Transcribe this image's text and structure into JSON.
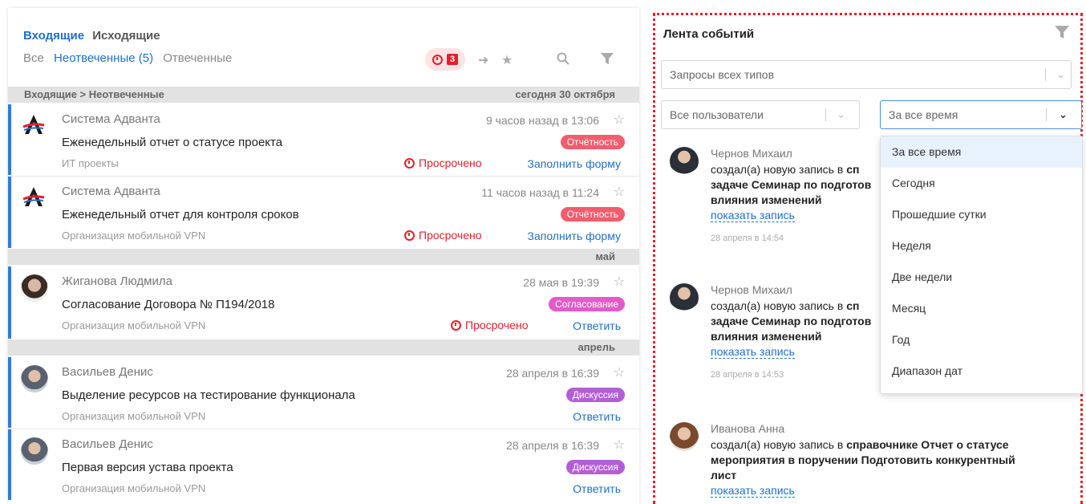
{
  "left": {
    "tabs_main": [
      "Входящие",
      "Исходящие"
    ],
    "tabs_sub": [
      "Все",
      "Неотвеченные (5)",
      "Отвеченные"
    ],
    "overdue_count": "3",
    "groups": [
      {
        "label": "Входящие  >  Неотвеченные",
        "date": "сегодня 30 октября"
      },
      {
        "label": "",
        "date": "май"
      },
      {
        "label": "",
        "date": "апрель"
      }
    ],
    "items": [
      {
        "sender": "Система Адванта",
        "time": "9 часов назад в 13:06",
        "title": "Еженедельный отчет о статусе проекта",
        "tag": "Отчётность",
        "tag_color": "#f25c6e",
        "org": "ИТ проекты",
        "overdue": "Просрочено",
        "action": "Заполнить форму"
      },
      {
        "sender": "Система Адванта",
        "time": "11 часов назад в 11:24",
        "title": "Еженедельный отчет для контроля сроков",
        "tag": "Отчётность",
        "tag_color": "#f25c6e",
        "org": "Организация мобильной VPN",
        "overdue": "Просрочено",
        "action": "Заполнить форму"
      },
      {
        "sender": "Жиганова Людмила",
        "time": "28 мая в 19:39",
        "title": "Согласование Договора № П194/2018",
        "tag": "Согласование",
        "tag_color": "#e55ac9",
        "org": "Организация мобильной VPN",
        "overdue": "Просрочено",
        "action": "Ответить"
      },
      {
        "sender": "Васильев Денис",
        "time": "28 апреля в 16:39",
        "title": "Выделение ресурсов на тестирование функционала",
        "tag": "Дискуссия",
        "tag_color": "#b35ed8",
        "org": "Организация мобильной VPN",
        "overdue": "",
        "action": "Ответить"
      },
      {
        "sender": "Васильев Денис",
        "time": "28 апреля в 16:39",
        "title": "Первая версия устава проекта",
        "tag": "Дискуссия",
        "tag_color": "#b35ed8",
        "org": "Организация мобильной VPN",
        "overdue": "",
        "action": "Ответить"
      }
    ]
  },
  "right": {
    "title": "Лента событий",
    "filter_types": "Запросы всех типов",
    "filter_users": "Все пользователи",
    "filter_period": "За все время",
    "events": [
      {
        "who": "Чернов Михаил",
        "line1_pre": "создал(а) новую запись в ",
        "line1_bold": "сп",
        "line2": "задаче Семинар по подготов",
        "line3": "влияния изменений",
        "link": "показать запись",
        "date": "28 апреля в 14:54"
      },
      {
        "who": "Чернов Михаил",
        "line1_pre": "создал(а) новую запись в ",
        "line1_bold": "сп",
        "line2": "задаче Семинар по подготов",
        "line3": "влияния изменений",
        "link": "показать запись",
        "date": "28 апреля в 14:53"
      },
      {
        "who": "Иванова Анна",
        "line1_pre": "создал(а) новую запись в ",
        "line1_bold": "справочнике Отчет о статусе",
        "line2": "мероприятия в поручении Подготовить конкурентный",
        "line3": "лист",
        "link": "показать запись",
        "date": ""
      }
    ],
    "period_options": [
      "За все время",
      "Сегодня",
      "Прошедшие сутки",
      "Неделя",
      "Две недели",
      "Месяц",
      "Год",
      "Диапазон дат"
    ]
  },
  "colors": {
    "accent": "#1e6fc9",
    "danger": "#e0202b",
    "focus_border": "#e0202b"
  }
}
